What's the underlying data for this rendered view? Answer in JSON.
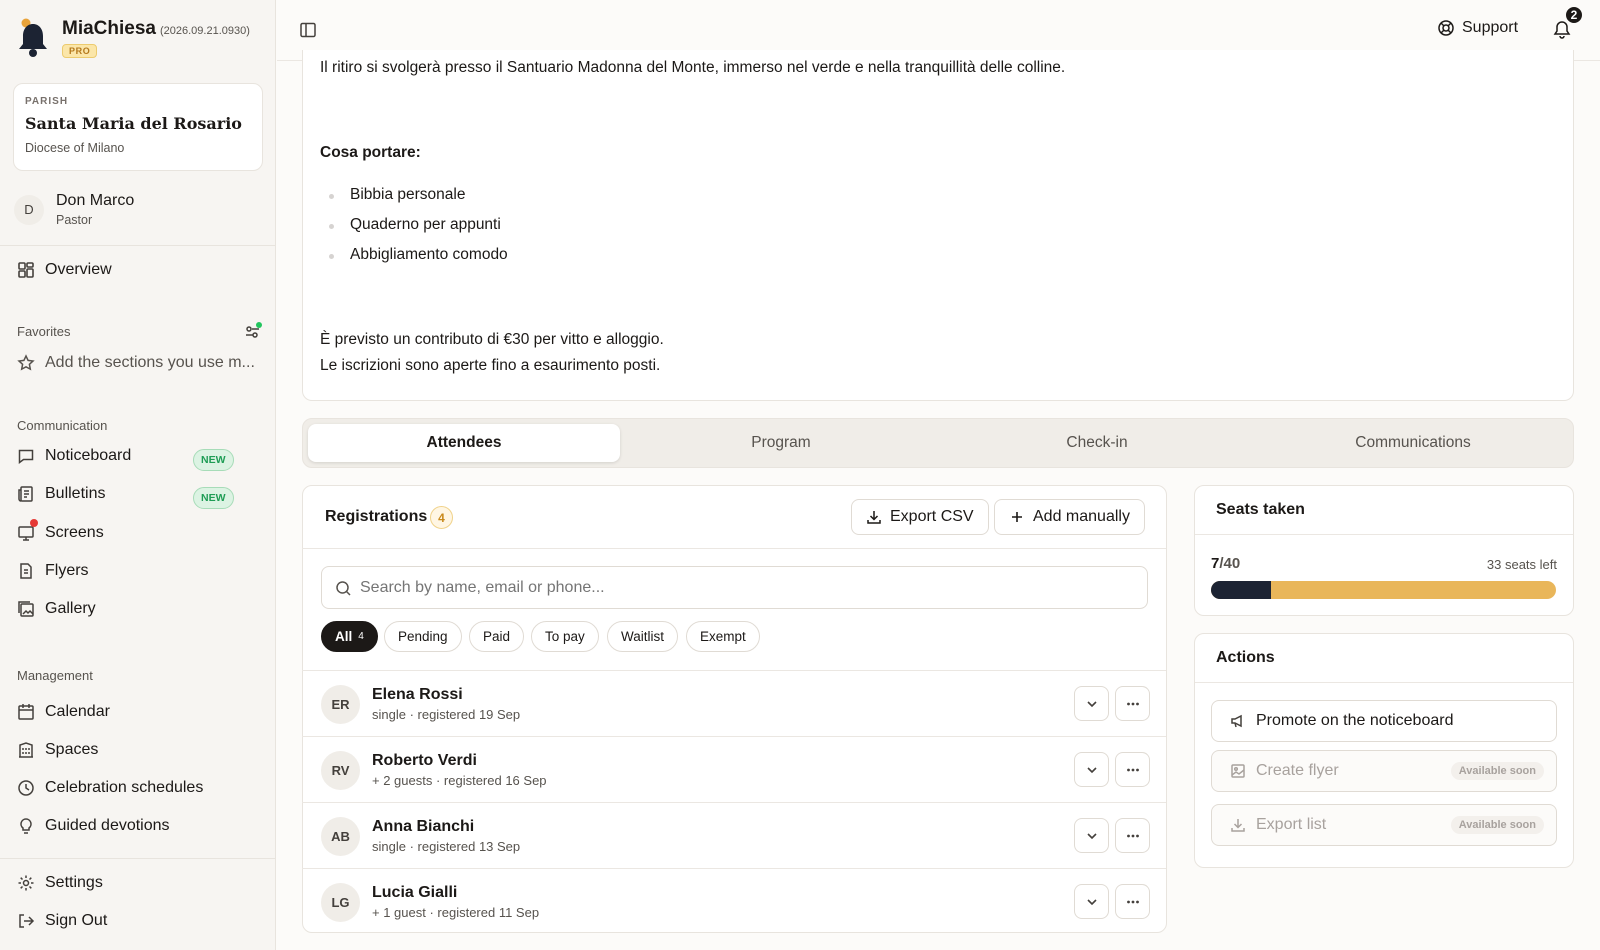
{
  "app": {
    "name": "MiaChiesa",
    "version": "(2026.09.21.0930)",
    "plan": "PRO"
  },
  "parish": {
    "kicker": "PARISH",
    "name": "Santa Maria del Rosario",
    "diocese": "Diocese of Milano"
  },
  "user": {
    "initial": "D",
    "name": "Don Marco",
    "role": "Pastor"
  },
  "sidebar": {
    "overview": "Overview",
    "favorites_label": "Favorites",
    "favorites_hint": "Add the sections you use m...",
    "communication_label": "Communication",
    "communication": [
      {
        "label": "Noticeboard",
        "badge": "NEW",
        "icon": "message-square-icon"
      },
      {
        "label": "Bulletins",
        "badge": "NEW",
        "icon": "newspaper-icon"
      },
      {
        "label": "Screens",
        "icon": "monitor-icon"
      },
      {
        "label": "Flyers",
        "icon": "file-text-icon"
      },
      {
        "label": "Gallery",
        "icon": "images-icon"
      }
    ],
    "management_label": "Management",
    "management": [
      {
        "label": "Calendar",
        "icon": "calendar-icon"
      },
      {
        "label": "Spaces",
        "icon": "building-icon"
      },
      {
        "label": "Celebration schedules",
        "icon": "clock-icon"
      },
      {
        "label": "Guided devotions",
        "icon": "lightbulb-icon"
      }
    ],
    "settings": "Settings",
    "sign_out": "Sign Out"
  },
  "topbar": {
    "support": "Support",
    "notifications_count": "2"
  },
  "description": {
    "intro": "Il ritiro si svolgerà presso il Santuario Madonna del Monte, immerso nel verde e nella tranquillità delle colline.",
    "bring_heading": "Cosa portare:",
    "bring_items": [
      "Bibbia personale",
      "Quaderno per appunti",
      "Abbigliamento comodo"
    ],
    "contribution": "È previsto un contributo di €30 per vitto e alloggio.",
    "registrations_note": "Le iscrizioni sono aperte fino a esaurimento posti."
  },
  "tabs": [
    "Attendees",
    "Program",
    "Check-in",
    "Communications"
  ],
  "registrations": {
    "title": "Registrations",
    "count": "4",
    "export_csv": "Export CSV",
    "add_manually": "Add manually",
    "search_placeholder": "Search by name, email or phone...",
    "filters": [
      {
        "label": "All",
        "count": "4"
      },
      {
        "label": "Pending"
      },
      {
        "label": "Paid"
      },
      {
        "label": "To pay"
      },
      {
        "label": "Waitlist"
      },
      {
        "label": "Exempt"
      }
    ],
    "rows": [
      {
        "initials": "ER",
        "name": "Elena Rossi",
        "meta": "single · registered 19 Sep"
      },
      {
        "initials": "RV",
        "name": "Roberto Verdi",
        "meta": "+ 2 guests · registered 16 Sep"
      },
      {
        "initials": "AB",
        "name": "Anna Bianchi",
        "meta": "single · registered 13 Sep"
      },
      {
        "initials": "LG",
        "name": "Lucia Gialli",
        "meta": "+ 1 guest · registered 11 Sep"
      }
    ]
  },
  "seats": {
    "title": "Seats taken",
    "taken": "7",
    "total": "/40",
    "left": "33 seats left",
    "taken_fraction": 0.175,
    "colors": {
      "taken": "#1c2333",
      "remaining": "#e9b65a"
    }
  },
  "actions": {
    "title": "Actions",
    "promote": "Promote on the noticeboard",
    "create_flyer": "Create flyer",
    "export_list": "Export list",
    "soon": "Available soon"
  }
}
